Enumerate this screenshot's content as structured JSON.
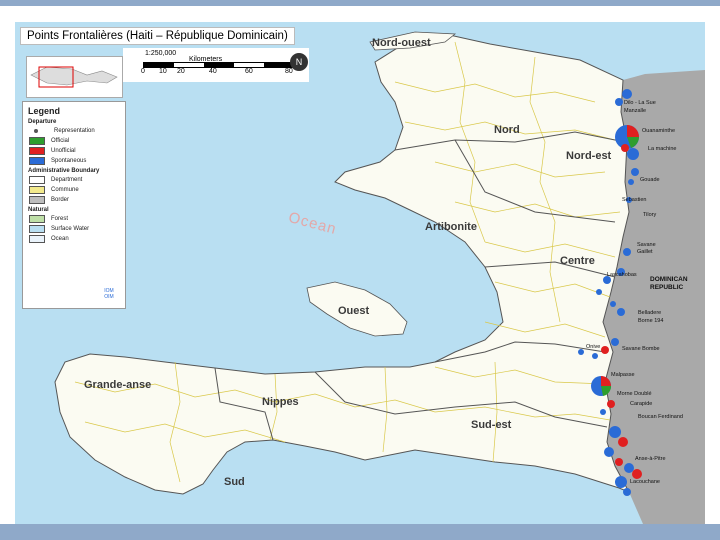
{
  "title": "Points Frontalières (Haiti – République Dominicain)",
  "scale": {
    "ratio": "1:250,000",
    "unit": "Kilometers",
    "ticks": [
      "0",
      "10",
      "20",
      "40",
      "60",
      "80"
    ]
  },
  "legend": {
    "title": "Legend",
    "sections": [
      {
        "heading": "Departure",
        "items": [
          {
            "label": "Representation",
            "kind": "dot",
            "color": "#555555"
          },
          {
            "label": "Official",
            "kind": "swatch",
            "color": "#2e9e2e"
          },
          {
            "label": "Unofficial",
            "kind": "swatch",
            "color": "#e02020"
          },
          {
            "label": "Spontaneous",
            "kind": "swatch",
            "color": "#2a6bd6"
          }
        ]
      },
      {
        "heading": "Administrative Boundary",
        "items": [
          {
            "label": "Department",
            "kind": "swatch",
            "color": "#ffffff"
          },
          {
            "label": "Commune",
            "kind": "swatch",
            "color": "#f3ea8c"
          },
          {
            "label": "Border",
            "kind": "swatch",
            "color": "#bdbdbd"
          }
        ]
      },
      {
        "heading": "Natural",
        "items": [
          {
            "label": "Forest",
            "kind": "swatch",
            "color": "#bfe0a8"
          },
          {
            "label": "Surface Water",
            "kind": "swatch",
            "color": "#b9dff2"
          },
          {
            "label": "Ocean",
            "kind": "swatch",
            "color": "#eaf3fb"
          }
        ]
      }
    ],
    "logo": "IOM OIM"
  },
  "map": {
    "ocean_label": "Ocean",
    "country_label": "DOMINICAN REPUBLIC",
    "departments": [
      "Nord-ouest",
      "Nord",
      "Nord-est",
      "Artibonite",
      "Centre",
      "Ouest",
      "Grande-anse",
      "Nippes",
      "Sud-est",
      "Sud"
    ],
    "crossing_points": [
      "Dilo - La Sue",
      "Manzalle",
      "Ouanaminthe",
      "La machine",
      "Gouade",
      "Sebastien",
      "Tilory",
      "Savane Gaillet",
      "Lascahobas",
      "Belladere",
      "Borne 194",
      "Onive",
      "Savane Bombe",
      "Malpasse",
      "Morne Doublé",
      "Carapide",
      "Boucan Ferdinand",
      "Anse-à-Pitre",
      "Lacouchane"
    ]
  },
  "colors": {
    "land": "#fbfbf2",
    "sea": "#b9dff2",
    "dr_land": "#a9a9a9",
    "commune_line": "#d9c84a",
    "department_line": "#555555",
    "official": "#2e9e2e",
    "unofficial": "#e02020",
    "spontaneous": "#2a6bd6"
  },
  "icons": {
    "north_arrow": "compass-icon",
    "iom_logo": "iom-logo-icon"
  }
}
